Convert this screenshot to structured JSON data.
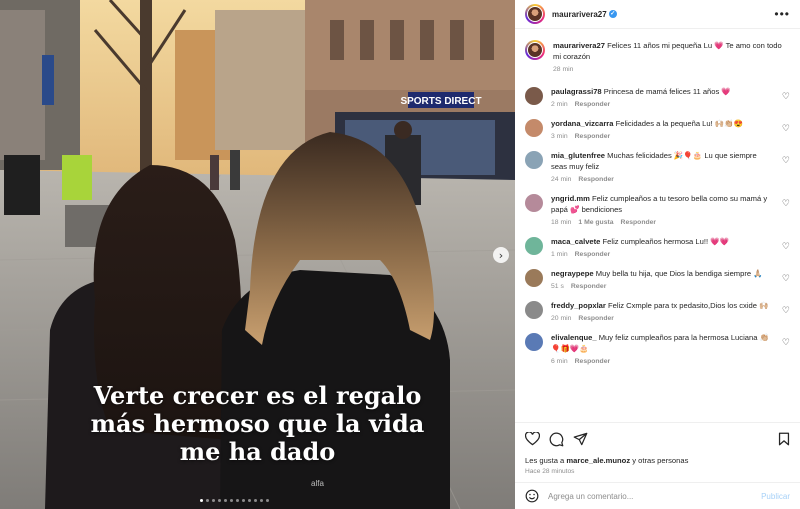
{
  "post": {
    "caption_lines": [
      "Verte crecer es el regalo",
      "más hermoso que la vida",
      "me ha dado"
    ],
    "watermark": "alfa",
    "store_sign": "SPORTS DIRECT",
    "slide_count": 12,
    "active_slide": 1
  },
  "header": {
    "username": "maurarivera27",
    "verified": true
  },
  "caption_comment": {
    "username": "maurarivera27",
    "text": "Felices 11 años mi pequeña Lu 💗 Te amo con todo mi corazón",
    "time": "28 min"
  },
  "comments": [
    {
      "username": "paulagrassi78",
      "text": "Princesa de mamá felices 11 años 💗",
      "time": "2 min",
      "likes": "",
      "reply": "Responder",
      "avatar_color": "#7a5a4a"
    },
    {
      "username": "yordana_vizcarra",
      "text": "Felicidades a la pequeña Lu! 🙌🏼👏🏼😍",
      "time": "3 min",
      "likes": "",
      "reply": "Responder",
      "avatar_color": "#c48a6a"
    },
    {
      "username": "mia_glutenfree",
      "text": "Muchas felicidades 🎉🎈🎂 Lu que siempre seas muy feliz",
      "time": "24 min",
      "likes": "",
      "reply": "Responder",
      "avatar_color": "#8aa3b5"
    },
    {
      "username": "yngrid.mm",
      "text": "Feliz cumpleaños a tu tesoro bella como su mamá y papá 💕 bendiciones",
      "time": "18 min",
      "likes": "1 Me gusta",
      "reply": "Responder",
      "avatar_color": "#b58a9a"
    },
    {
      "username": "maca_calvete",
      "text": "Feliz cumpleaños hermosa Lu!! 💗💗",
      "time": "1 min",
      "likes": "",
      "reply": "Responder",
      "avatar_color": "#6fb59a"
    },
    {
      "username": "negraypepe",
      "text": "Muy bella tu hija, que Dios la bendiga siempre 🙏🏼",
      "time": "51 s",
      "likes": "",
      "reply": "Responder",
      "avatar_color": "#9a7a5a"
    },
    {
      "username": "freddy_popxlar",
      "text": "Feliz Cxmple para tx pedasito,Dios los cxide 🙌🏼",
      "time": "20 min",
      "likes": "",
      "reply": "Responder",
      "avatar_color": "#8a8a8a"
    },
    {
      "username": "elivalenque_",
      "text": "Muy feliz cumpleaños para la hermosa Luciana 👏🏼🎈🎁💗🎂",
      "time": "6 min",
      "likes": "",
      "reply": "Responder",
      "avatar_color": "#5a7ab5"
    }
  ],
  "engagement": {
    "likes_prefix": "Les gusta a",
    "liked_by": "marce_ale.munoz",
    "likes_suffix": "y otras personas",
    "posted_ago": "Hace 28 minutos"
  },
  "add_comment": {
    "placeholder": "Agrega un comentario...",
    "publish_label": "Publicar"
  },
  "colors": {
    "accent": "#3897f0",
    "publish_disabled": "#a7d1f8",
    "secondary_text": "#8e8e8e"
  }
}
